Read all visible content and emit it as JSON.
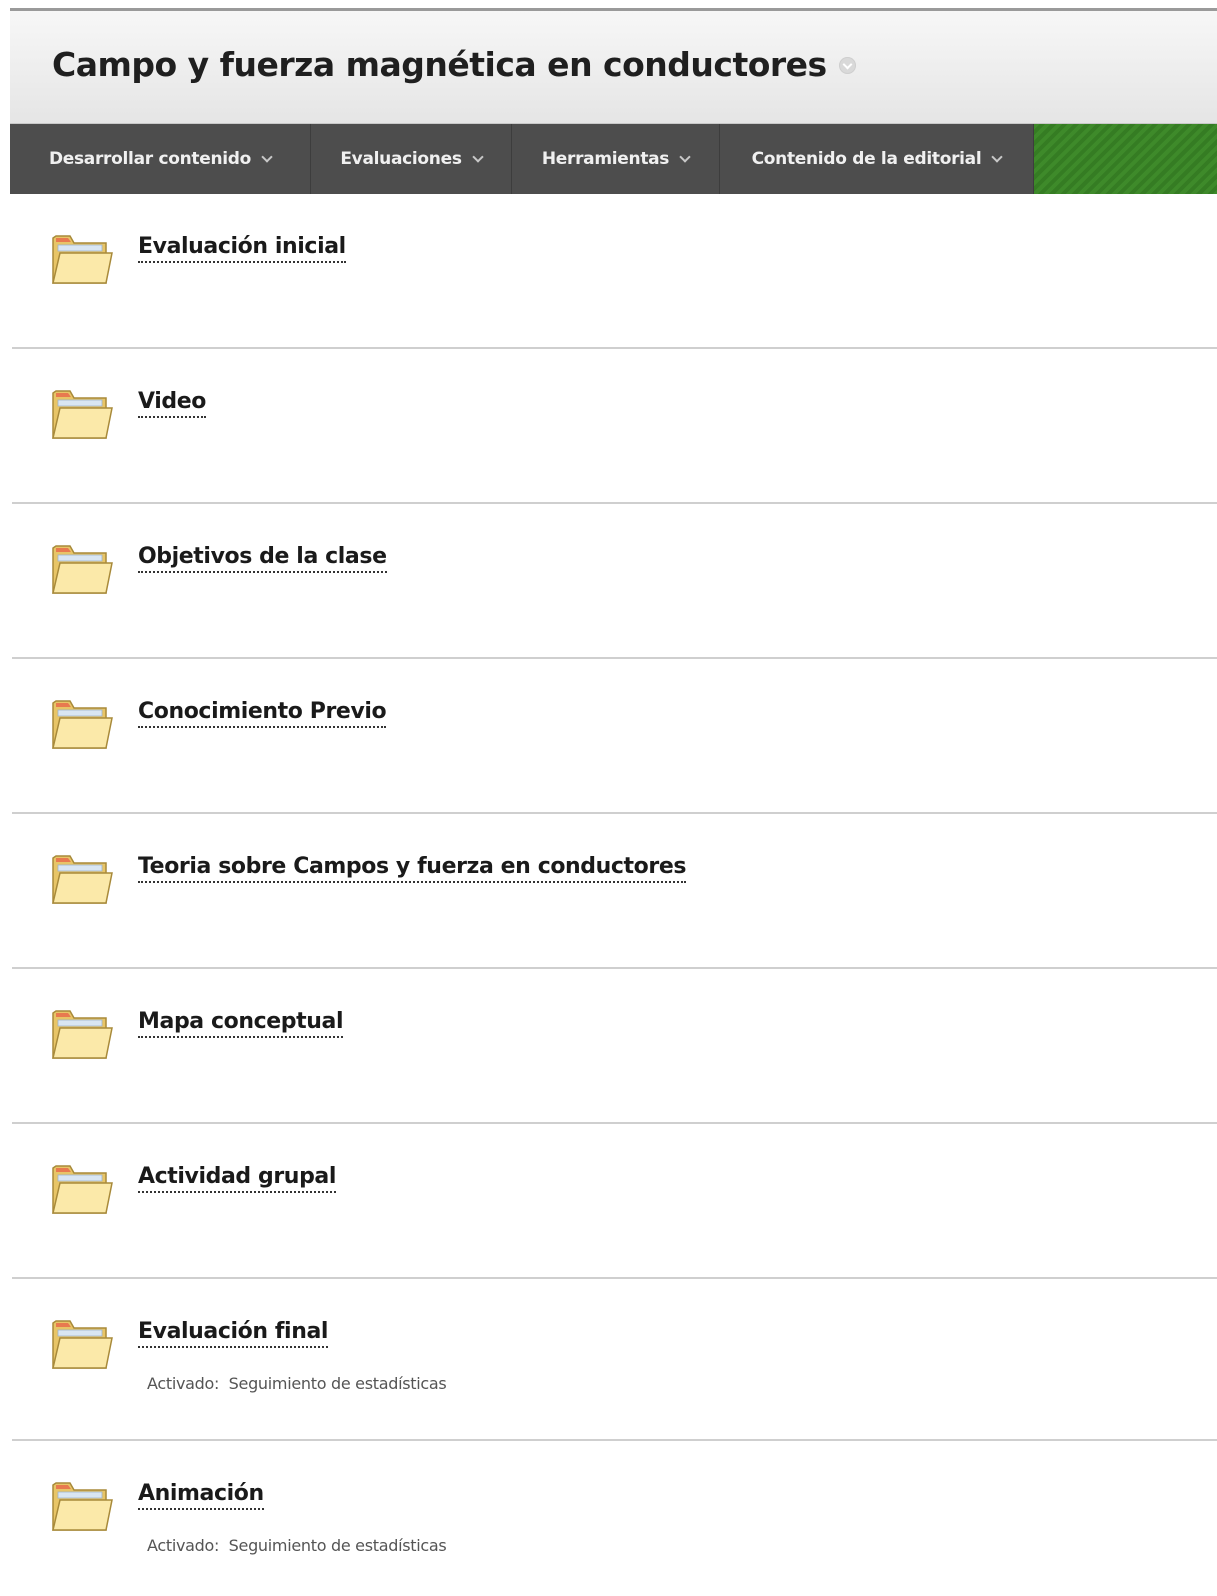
{
  "page": {
    "title": "Campo y fuerza magnética en conductores"
  },
  "menu": {
    "items": [
      {
        "label": "Desarrollar contenido",
        "name": "menu-desarrollar-contenido"
      },
      {
        "label": "Evaluaciones",
        "name": "menu-evaluaciones"
      },
      {
        "label": "Herramientas",
        "name": "menu-herramientas"
      },
      {
        "label": "Contenido de la editorial",
        "name": "menu-contenido-editorial"
      }
    ]
  },
  "content": {
    "items": [
      {
        "title": "Evaluación inicial",
        "icon": "folder-icon"
      },
      {
        "title": "Video",
        "icon": "folder-icon"
      },
      {
        "title": "Objetivos de la clase",
        "icon": "folder-icon"
      },
      {
        "title": "Conocimiento Previo",
        "icon": "folder-icon"
      },
      {
        "title": "Teoria sobre Campos y fuerza en conductores",
        "icon": "folder-icon"
      },
      {
        "title": "Mapa conceptual",
        "icon": "folder-icon"
      },
      {
        "title": "Actividad grupal",
        "icon": "folder-icon"
      },
      {
        "title": "Evaluación final",
        "icon": "folder-icon",
        "meta_label": "Activado:",
        "meta_value": "Seguimiento de estadísticas"
      },
      {
        "title": "Animación",
        "icon": "folder-icon",
        "meta_label": "Activado:",
        "meta_value": "Seguimiento de estadísticas"
      }
    ]
  },
  "colors": {
    "nav_background": "#4d4d4d",
    "nav_accent_green": "#3e8a2a",
    "header_background": "#eeeeee"
  }
}
